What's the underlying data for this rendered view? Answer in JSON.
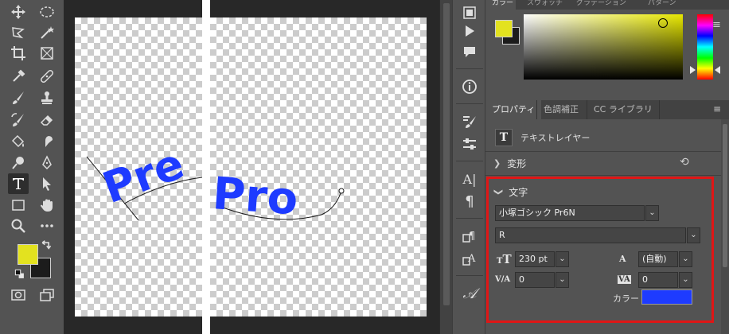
{
  "canvas": {
    "left_text": "Pre",
    "right_text": "Pro",
    "text_color": "#1e3bff"
  },
  "toolbar": {
    "foreground_color": "#e3e21f",
    "background_color": "#1c1c1c",
    "tools": [
      "move-icon",
      "marquee-icon",
      "lasso-icon",
      "magic-wand-icon",
      "crop-icon",
      "frame-icon",
      "eyedropper-icon",
      "healing-icon",
      "brush-icon",
      "stamp-icon",
      "history-brush-icon",
      "eraser-icon",
      "paint-bucket-icon",
      "smudge-icon",
      "dodge-icon",
      "pen-icon",
      "type-icon",
      "path-select-icon",
      "rectangle-icon",
      "hand-icon",
      "zoom-icon",
      "more-icon"
    ]
  },
  "color_panel": {
    "tabs": [
      "カラー",
      "スウォッチ",
      "グラデーション",
      "パターン"
    ],
    "picker_base": "#e8e800"
  },
  "properties": {
    "tabs": [
      "プロパティ",
      "色調補正",
      "CC ライブラリ"
    ],
    "layer_type": "テキストレイヤー",
    "transform_label": "変形",
    "character": {
      "header": "文字",
      "font_family": "小塚ゴシック Pr6N",
      "font_style": "R",
      "font_size": "230 pt",
      "leading": "(自動)",
      "kerning": "0",
      "tracking": "0",
      "color_label": "カラー",
      "color_value": "#1e3bff",
      "size_icon": "T",
      "leading_icon": "A",
      "kerning_icon": "V/A",
      "tracking_icon": "VA"
    }
  }
}
